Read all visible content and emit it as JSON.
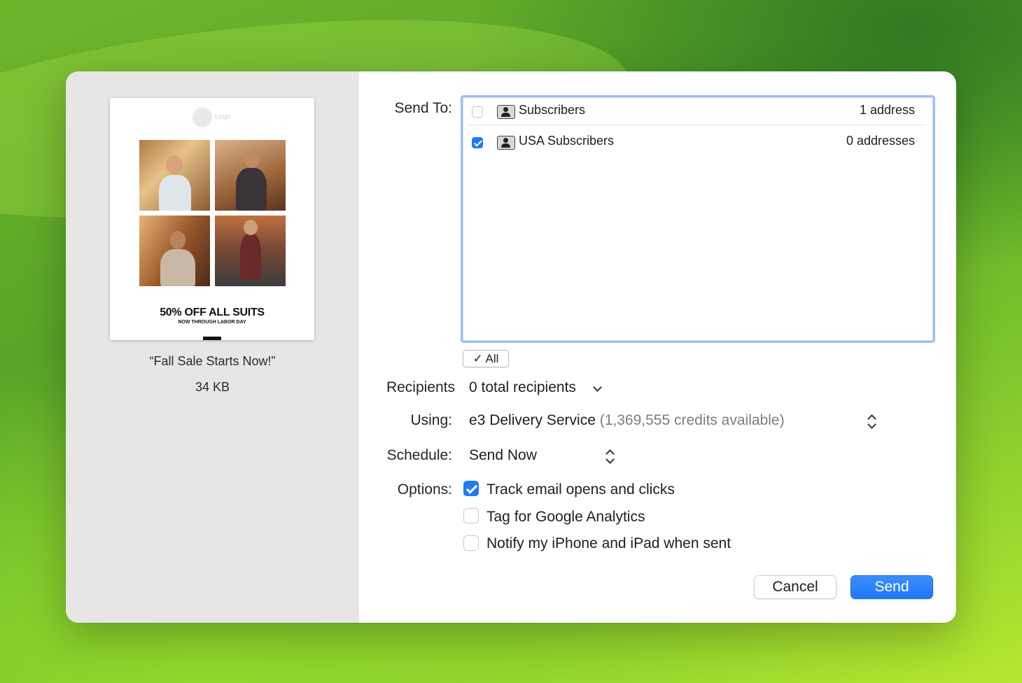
{
  "preview": {
    "logo_text": "Logo",
    "headline": "50% OFF ALL SUITS",
    "subheadline": "NOW THROUGH LABOR DAY",
    "name": "“Fall Sale Starts Now!”",
    "size": "34 KB"
  },
  "send_to": {
    "label": "Send To:",
    "lists": [
      {
        "name": "Subscribers",
        "count": "1 address",
        "checked": false,
        "icon": "contact-group-icon"
      },
      {
        "name": "USA Subscribers",
        "count": "0 addresses",
        "checked": true,
        "icon": "contact-group-icon"
      }
    ],
    "all_button": "✓ All"
  },
  "recipients": {
    "label": "Recipients",
    "value": "0 total recipients"
  },
  "using": {
    "label": "Using:",
    "service": "e3 Delivery Service",
    "credits": "(1,369,555 credits available)"
  },
  "schedule": {
    "label": "Schedule:",
    "value": "Send Now"
  },
  "options": {
    "label": "Options:",
    "items": [
      {
        "text": "Track email opens and clicks",
        "checked": true
      },
      {
        "text": "Tag for Google Analytics",
        "checked": false
      },
      {
        "text": "Notify my iPhone and iPad when sent",
        "checked": false
      }
    ]
  },
  "buttons": {
    "cancel": "Cancel",
    "send": "Send"
  },
  "colors": {
    "accent": "#1f7bf5",
    "list_focus_border": "#a2bdf0",
    "sidebar_bg": "#e7e6e5"
  }
}
